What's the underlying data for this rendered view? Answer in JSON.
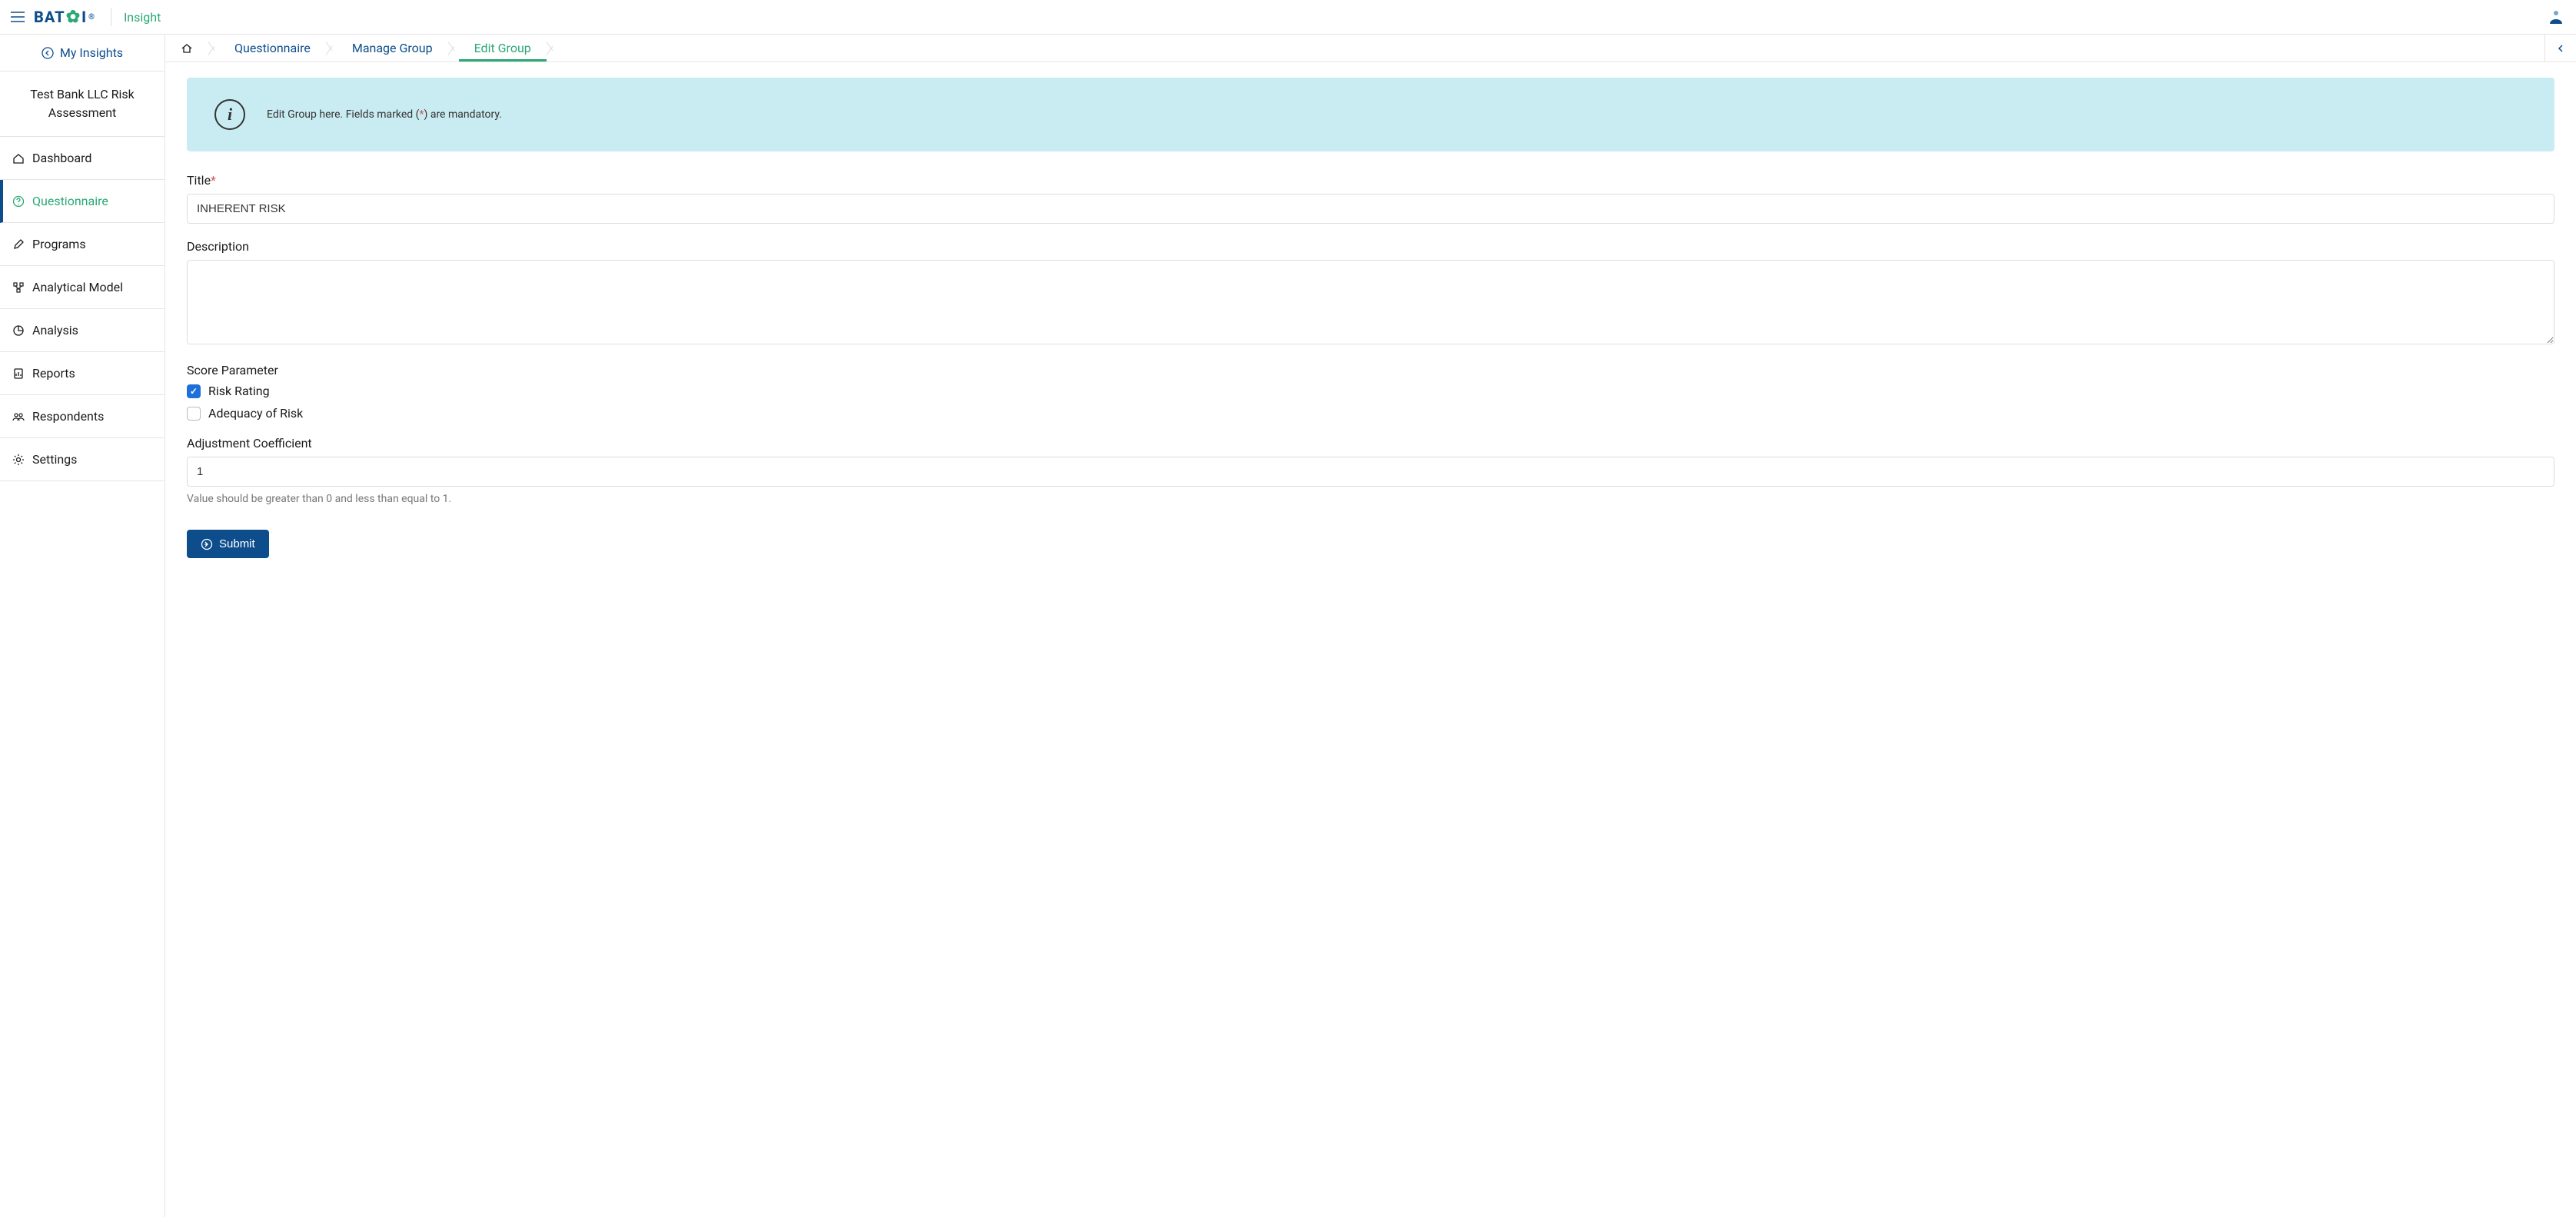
{
  "header": {
    "logo_text": "BAT",
    "logo_text2": "I",
    "logo_reg": "®",
    "app_name": "Insight"
  },
  "sidebar": {
    "my_insights": "My Insights",
    "project_title": "Test Bank LLC Risk Assessment",
    "items": [
      {
        "label": "Dashboard"
      },
      {
        "label": "Questionnaire"
      },
      {
        "label": "Programs"
      },
      {
        "label": "Analytical Model"
      },
      {
        "label": "Analysis"
      },
      {
        "label": "Reports"
      },
      {
        "label": "Respondents"
      },
      {
        "label": "Settings"
      }
    ]
  },
  "breadcrumb": {
    "items": [
      {
        "label": "Questionnaire"
      },
      {
        "label": "Manage Group"
      },
      {
        "label": "Edit Group"
      }
    ]
  },
  "info": {
    "text_before": "Edit Group here. Fields marked (",
    "star": "*",
    "text_after": ") are mandatory."
  },
  "form": {
    "title_label": "Title",
    "title_value": "INHERENT RISK",
    "description_label": "Description",
    "description_value": "",
    "score_param_label": "Score Parameter",
    "checkbox1_label": "Risk Rating",
    "checkbox2_label": "Adequacy of Risk",
    "adj_label": "Adjustment Coefficient",
    "adj_value": "1",
    "adj_help": "Value should be greater than 0 and less than equal to 1.",
    "submit_label": "Submit"
  }
}
